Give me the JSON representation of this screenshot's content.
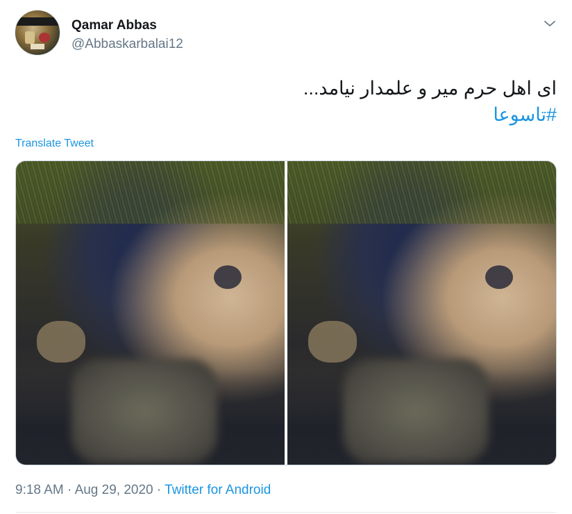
{
  "tweet": {
    "author_name": "Qamar Abbas",
    "author_handle": "@Abbaskarbalai12",
    "text": "ای اهل حرم میر و علمدار نیامد...",
    "hashtag": "#تاسوعا",
    "translate_label": "Translate Tweet",
    "time": "9:18 AM",
    "date": "Aug 29, 2020",
    "separator": "·",
    "source": "Twitter for Android"
  },
  "icons": {
    "menu": "chevron-down-icon"
  },
  "colors": {
    "link": "#1b95e0",
    "secondary_text": "#657786",
    "primary_text": "#14171a"
  }
}
